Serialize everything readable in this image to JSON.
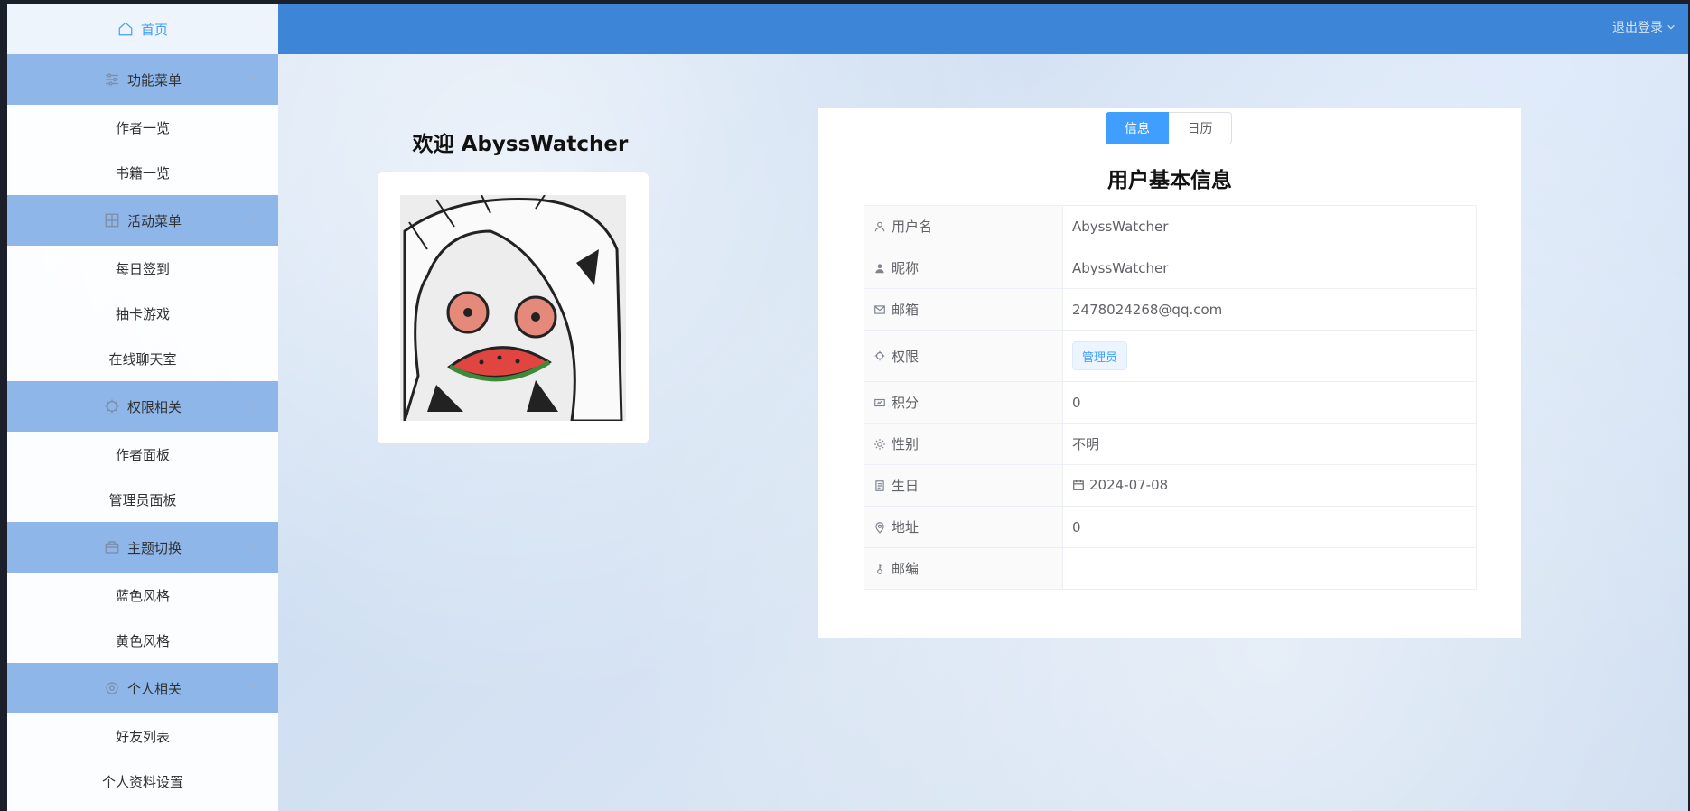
{
  "sidebar": {
    "home_label": "首页",
    "menus": [
      {
        "title": "功能菜单",
        "icon": "sliders-icon",
        "items": [
          "作者一览",
          "书籍一览"
        ]
      },
      {
        "title": "活动菜单",
        "icon": "grid-icon",
        "items": [
          "每日签到",
          "抽卡游戏",
          "在线聊天室"
        ]
      },
      {
        "title": "权限相关",
        "icon": "cpu-icon",
        "items": [
          "作者面板",
          "管理员面板"
        ]
      },
      {
        "title": "主题切换",
        "icon": "briefcase-icon",
        "items": [
          "蓝色风格",
          "黄色风格"
        ]
      },
      {
        "title": "个人相关",
        "icon": "settings-icon",
        "items": [
          "好友列表",
          "个人资料设置"
        ]
      }
    ]
  },
  "header": {
    "logout_label": "退出登录"
  },
  "welcome": {
    "title": "欢迎 AbyssWatcher"
  },
  "info": {
    "tabs": [
      "信息",
      "日历"
    ],
    "active_tab": "信息",
    "title": "用户基本信息",
    "rows": [
      {
        "label": "用户名",
        "icon": "user-icon",
        "value": "AbyssWatcher"
      },
      {
        "label": "昵称",
        "icon": "user-filled-icon",
        "value": "AbyssWatcher"
      },
      {
        "label": "邮箱",
        "icon": "mail-icon",
        "value": "2478024268@qq.com"
      },
      {
        "label": "权限",
        "icon": "cpu-icon",
        "value": "管理员",
        "kind": "tag"
      },
      {
        "label": "积分",
        "icon": "ticket-icon",
        "value": "0"
      },
      {
        "label": "性别",
        "icon": "sun-icon",
        "value": "不明"
      },
      {
        "label": "生日",
        "icon": "document-icon",
        "value": "2024-07-08",
        "kind": "date"
      },
      {
        "label": "地址",
        "icon": "location-icon",
        "value": "0"
      },
      {
        "label": "邮编",
        "icon": "key-icon",
        "value": ""
      }
    ]
  },
  "colors": {
    "accent": "#409eff",
    "header": "#3d85d6",
    "submenu": "#8fb6e9"
  }
}
